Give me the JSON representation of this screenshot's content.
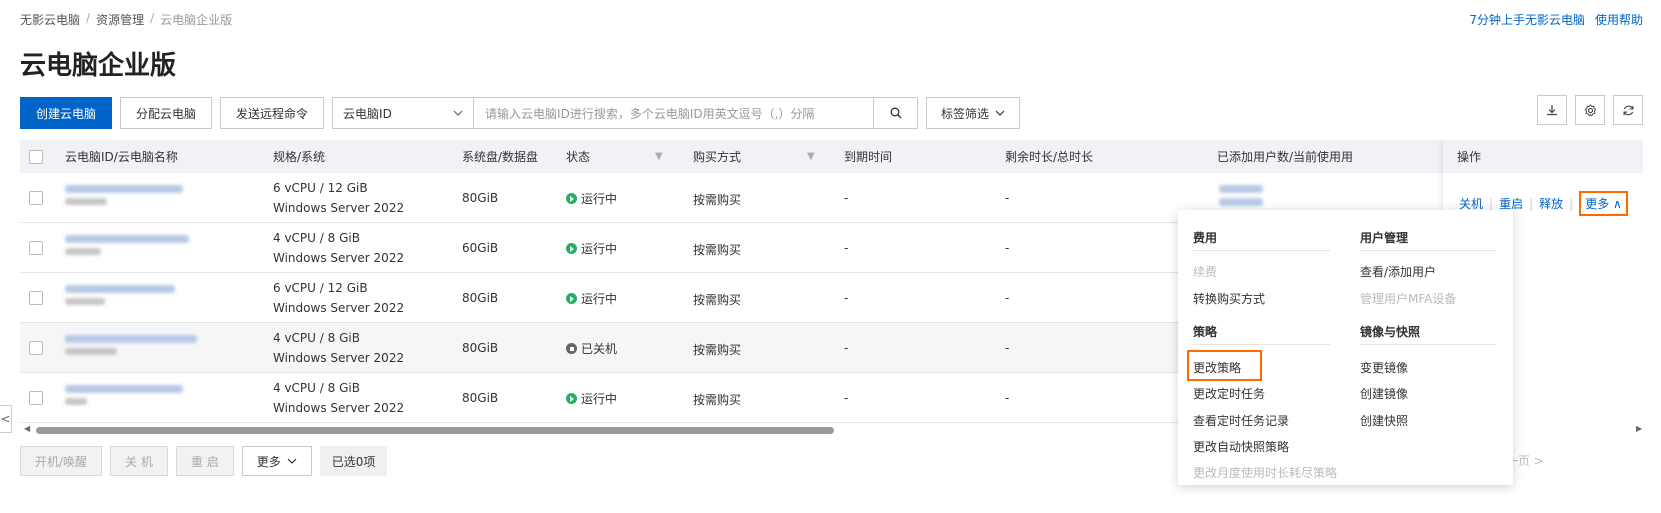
{
  "breadcrumb": [
    "无影云电脑",
    "资源管理",
    "云电脑企业版"
  ],
  "top_links": [
    "7分钟上手无影云电脑",
    "使用帮助"
  ],
  "page_title": "云电脑企业版",
  "toolbar": {
    "create": "创建云电脑",
    "assign": "分配云电脑",
    "send_command": "发送远程命令",
    "search_field": "云电脑ID",
    "search_placeholder": "请输入云电脑ID进行搜索，多个云电脑ID用英文逗号（,）分隔",
    "tag_filter": "标签筛选"
  },
  "icons": {
    "download": "download-icon",
    "settings": "gear-icon",
    "refresh": "refresh-icon",
    "search": "search-icon",
    "chevron": "chevron-down-icon",
    "filter": "filter-icon"
  },
  "table": {
    "headers": [
      "云电脑ID/云电脑名称",
      "规格/系统",
      "系统盘/数据盘",
      "状态",
      "购买方式",
      "到期时间",
      "剩余时长/总时长",
      "已添加用户数/当前使用用"
    ],
    "ops_header": "操作",
    "rows": [
      {
        "spec1": "6 vCPU / 12 GiB",
        "spec2": "Windows Server 2022",
        "disk": "80GiB",
        "status": "运行中",
        "state": "run",
        "purchase": "按需购买",
        "expire": "-",
        "remain": "-"
      },
      {
        "spec1": "4 vCPU / 8 GiB",
        "spec2": "Windows Server 2022",
        "disk": "60GiB",
        "status": "运行中",
        "state": "run",
        "purchase": "按需购买",
        "expire": "-",
        "remain": "-"
      },
      {
        "spec1": "6 vCPU / 12 GiB",
        "spec2": "Windows Server 2022",
        "disk": "80GiB",
        "status": "运行中",
        "state": "run",
        "purchase": "按需购买",
        "expire": "-",
        "remain": "-"
      },
      {
        "spec1": "4 vCPU / 8 GiB",
        "spec2": "Windows Server 2022",
        "disk": "80GiB",
        "status": "已关机",
        "state": "stop",
        "purchase": "按需购买",
        "expire": "-",
        "remain": "-"
      },
      {
        "spec1": "4 vCPU / 8 GiB",
        "spec2": "Windows Server 2022",
        "disk": "80GiB",
        "status": "运行中",
        "state": "run",
        "purchase": "按需购买",
        "expire": "-",
        "remain": "-"
      }
    ],
    "row_ops": {
      "shutdown": "关机",
      "restart": "重启",
      "release": "释放",
      "more": "更多"
    }
  },
  "dropdown": {
    "fee_title": "费用",
    "fee_items": [
      "续费",
      "转换购买方式"
    ],
    "policy_title": "策略",
    "policy_items": [
      "更改策略",
      "更改定时任务",
      "查看定时任务记录",
      "更改自动快照策略",
      "更改月度使用时长耗尽策略"
    ],
    "user_title": "用户管理",
    "user_items": [
      "查看/添加用户",
      "管理用户MFA设备"
    ],
    "image_title": "镜像与快照",
    "image_items": [
      "变更镜像",
      "创建镜像",
      "创建快照"
    ]
  },
  "bottom": {
    "start": "开机/唤醒",
    "shutdown": "关 机",
    "restart": "重 启",
    "more": "更多",
    "selected": "已选0项",
    "next_page": "一页 >"
  },
  "colors": {
    "primary": "#0064c8",
    "highlight": "#ff6a00",
    "running": "#23b066"
  }
}
